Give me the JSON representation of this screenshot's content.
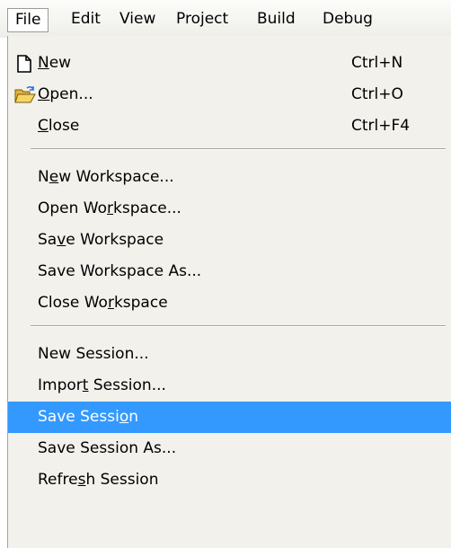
{
  "menubar": {
    "items": [
      {
        "label": "File",
        "active": true
      },
      {
        "label": "Edit"
      },
      {
        "label": "View"
      },
      {
        "label": "Project"
      },
      {
        "label": "Build"
      },
      {
        "label": "Debug"
      }
    ]
  },
  "file_menu": {
    "items": [
      {
        "label": "New",
        "mnemonic_index": 0,
        "shortcut": "Ctrl+N",
        "icon": "new-file-icon"
      },
      {
        "label": "Open...",
        "mnemonic_index": 0,
        "shortcut": "Ctrl+O",
        "icon": "open-folder-icon"
      },
      {
        "label": "Close",
        "mnemonic_index": 0,
        "shortcut": "Ctrl+F4"
      },
      {
        "label": "New Workspace...",
        "mnemonic_index": 1
      },
      {
        "label": "Open Workspace...",
        "mnemonic_index": 7
      },
      {
        "label": "Save Workspace",
        "mnemonic_index": 2
      },
      {
        "label": "Save Workspace As...",
        "mnemonic_index": -1
      },
      {
        "label": "Close Workspace",
        "mnemonic_index": 8
      },
      {
        "label": "New Session...",
        "mnemonic_index": -1
      },
      {
        "label": "Import Session...",
        "mnemonic_index": 5
      },
      {
        "label": "Save Session",
        "mnemonic_index": 10,
        "highlighted": true
      },
      {
        "label": "Save Session As...",
        "mnemonic_index": -1
      },
      {
        "label": "Refresh Session",
        "mnemonic_index": 5
      }
    ]
  },
  "colors": {
    "highlight": "#3399ff",
    "menu_background": "#f2f1ec"
  }
}
